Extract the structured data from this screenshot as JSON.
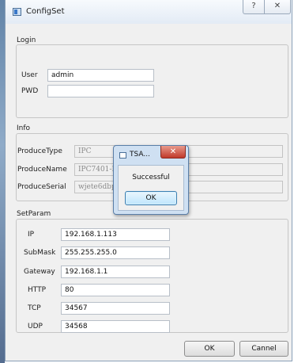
{
  "window": {
    "title": "ConfigSet",
    "help_glyph": "?",
    "close_glyph": "✕"
  },
  "login": {
    "title": "Login",
    "user_label": "User",
    "user_value": "admin",
    "pwd_label": "PWD",
    "pwd_value": ""
  },
  "info": {
    "title": "Info",
    "fields": [
      {
        "label": "ProduceType",
        "value": "IPC"
      },
      {
        "label": "ProduceName",
        "value": "IPC7401-F"
      },
      {
        "label": "ProduceSerial",
        "value": "wjete6dbp"
      }
    ]
  },
  "setparam": {
    "title": "SetParam",
    "fields": [
      {
        "label": "IP",
        "value": "192.168.1.113"
      },
      {
        "label": "SubMask",
        "value": "255.255.255.0"
      },
      {
        "label": "Gateway",
        "value": "192.168.1.1"
      },
      {
        "label": "HTTP",
        "value": "80"
      },
      {
        "label": "TCP",
        "value": "34567"
      },
      {
        "label": "UDP",
        "value": "34568"
      }
    ]
  },
  "buttons": {
    "ok": "OK",
    "cancel": "Cannel"
  },
  "dialog": {
    "title": "TSA...",
    "close_glyph": "✕",
    "message": "Successful",
    "ok": "OK"
  },
  "icons": {
    "app": "window-app-icon",
    "help": "question-mark-icon",
    "close": "close-x-icon"
  },
  "colors": {
    "dialog_close": "#c0392b",
    "dialog_frame": "#cfe0f2"
  }
}
